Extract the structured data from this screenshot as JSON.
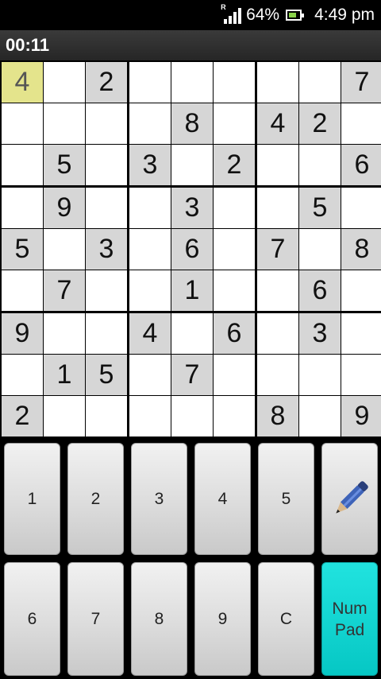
{
  "status": {
    "battery_percent": "64%",
    "time": "4:49 pm",
    "signal_roaming": "R"
  },
  "timer": "00:11",
  "board": {
    "selected_cell": [
      0,
      0
    ],
    "rows": [
      [
        "4",
        "",
        "2",
        "",
        "",
        "",
        "",
        "",
        "7"
      ],
      [
        "",
        "",
        "",
        "",
        "8",
        "",
        "4",
        "2",
        ""
      ],
      [
        "",
        "5",
        "",
        "3",
        "",
        "2",
        "",
        "",
        "6"
      ],
      [
        "",
        "9",
        "",
        "",
        "3",
        "",
        "",
        "5",
        ""
      ],
      [
        "5",
        "",
        "3",
        "",
        "6",
        "",
        "7",
        "",
        "8"
      ],
      [
        "",
        "7",
        "",
        "",
        "1",
        "",
        "",
        "6",
        ""
      ],
      [
        "9",
        "",
        "",
        "4",
        "",
        "6",
        "",
        "3",
        ""
      ],
      [
        "",
        "1",
        "5",
        "",
        "7",
        "",
        "",
        "",
        ""
      ],
      [
        "2",
        "",
        "",
        "",
        "",
        "",
        "8",
        "",
        "9"
      ]
    ]
  },
  "keypad": {
    "row1": [
      "1",
      "2",
      "3",
      "4",
      "5"
    ],
    "row2": [
      "6",
      "7",
      "8",
      "9",
      "C"
    ],
    "pencil_icon": "pencil-icon",
    "numpad_line1": "Num",
    "numpad_line2": "Pad",
    "numpad_color": "#0fd6d3"
  }
}
